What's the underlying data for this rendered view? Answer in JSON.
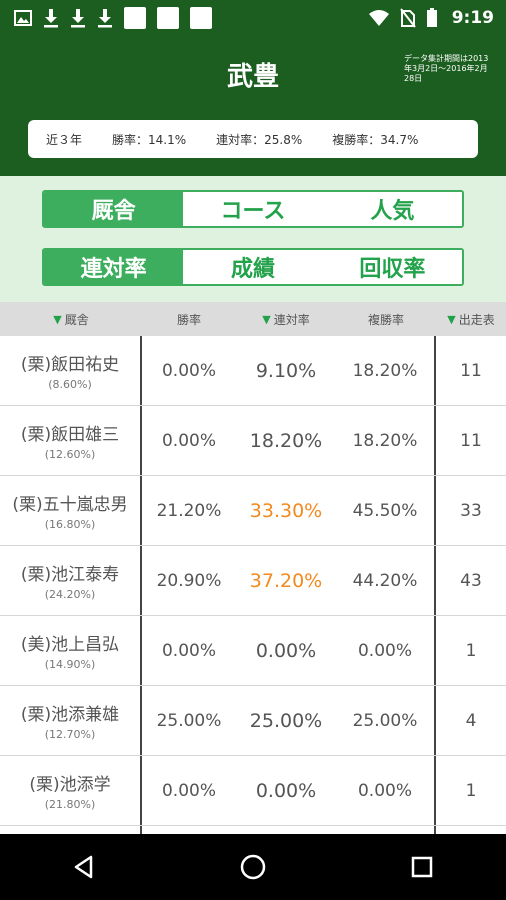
{
  "status_bar": {
    "time": "9:19",
    "left_icons": [
      "image-icon",
      "download-icon",
      "download-icon",
      "download-icon",
      "blank-square",
      "blank-square",
      "blank-square"
    ],
    "right_icons": [
      "wifi-icon",
      "no-sim-icon",
      "battery-icon"
    ]
  },
  "header": {
    "title": "武豊",
    "period_note": "データ集計期間は2013年3月2日〜2016年2月28日"
  },
  "stats": {
    "period": "近３年",
    "win_rate": "勝率：14.1%",
    "place_rate": "連対率：25.8%",
    "show_rate": "複勝率：34.7%"
  },
  "category_tabs": [
    {
      "label": "厩舎",
      "active": true
    },
    {
      "label": "コース",
      "active": false
    },
    {
      "label": "人気",
      "active": false
    }
  ],
  "metric_tabs": [
    {
      "label": "連対率",
      "active": true
    },
    {
      "label": "成績",
      "active": false
    },
    {
      "label": "回収率",
      "active": false
    }
  ],
  "table": {
    "headers": [
      "▼厩舎",
      "勝率",
      "▼連対率",
      "複勝率",
      "▼出走表"
    ],
    "rows": [
      {
        "trainer": "(栗)飯田祐史",
        "rate": "(8.60%)",
        "win": "0.00%",
        "place": "9.10%",
        "show": "18.20%",
        "runs": "11",
        "highlight": false
      },
      {
        "trainer": "(栗)飯田雄三",
        "rate": "(12.60%)",
        "win": "0.00%",
        "place": "18.20%",
        "show": "18.20%",
        "runs": "11",
        "highlight": false
      },
      {
        "trainer": "(栗)五十嵐忠男",
        "rate": "(16.80%)",
        "win": "21.20%",
        "place": "33.30%",
        "show": "45.50%",
        "runs": "33",
        "highlight": true
      },
      {
        "trainer": "(栗)池江泰寿",
        "rate": "(24.20%)",
        "win": "20.90%",
        "place": "37.20%",
        "show": "44.20%",
        "runs": "43",
        "highlight": true
      },
      {
        "trainer": "(美)池上昌弘",
        "rate": "(14.90%)",
        "win": "0.00%",
        "place": "0.00%",
        "show": "0.00%",
        "runs": "1",
        "highlight": false
      },
      {
        "trainer": "(栗)池添兼雄",
        "rate": "(12.70%)",
        "win": "25.00%",
        "place": "25.00%",
        "show": "25.00%",
        "runs": "4",
        "highlight": false
      },
      {
        "trainer": "(栗)池添学",
        "rate": "(21.80%)",
        "win": "0.00%",
        "place": "0.00%",
        "show": "0.00%",
        "runs": "1",
        "highlight": false
      },
      {
        "trainer": "",
        "rate": "",
        "win": "",
        "place": "",
        "show": "",
        "runs": "",
        "highlight": false
      }
    ]
  },
  "colors": {
    "header_green": "#1b5e20",
    "accent_green": "#3cae5d",
    "highlight_orange": "#f28a1e",
    "filter_bg": "#dff1df"
  },
  "nav": [
    "back-icon",
    "home-icon",
    "recents-icon"
  ]
}
